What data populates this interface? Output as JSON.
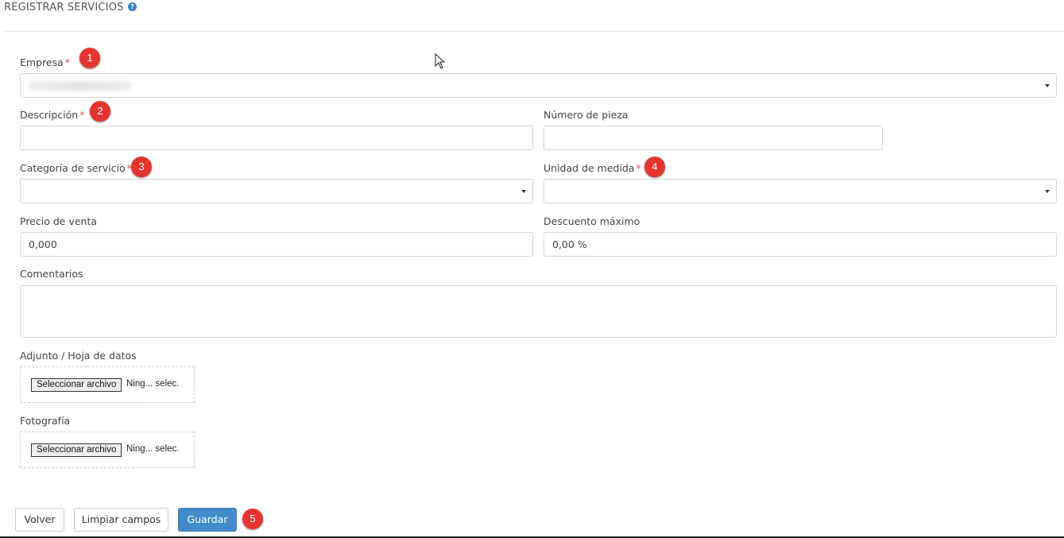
{
  "header": {
    "title": "REGISTRAR SERVICIOS",
    "help_icon": "?"
  },
  "form": {
    "empresa": {
      "label": "Empresa",
      "required": "*",
      "value_redacted": true
    },
    "descripcion": {
      "label": "Descripción",
      "required": "*",
      "value": ""
    },
    "numero_pieza": {
      "label": "Número de pieza",
      "value": ""
    },
    "categoria": {
      "label": "Categoría de servicio",
      "required": "*",
      "value": ""
    },
    "unidad": {
      "label": "Unidad de medida",
      "required": "*",
      "value": ""
    },
    "precio": {
      "label": "Precio de venta",
      "value": "0,000"
    },
    "descuento": {
      "label": "Descuento máximo",
      "value": "0,00 %"
    },
    "comentarios": {
      "label": "Comentarios",
      "value": ""
    },
    "adjunto": {
      "label": "Adjunto / Hoja de datos",
      "button": "Seleccionar archivo",
      "status": "Ning... selec."
    },
    "fotografia": {
      "label": "Fotografía",
      "button": "Seleccionar archivo",
      "status": "Ning... selec."
    }
  },
  "actions": {
    "back": "Volver",
    "clear": "Limpiar campos",
    "save": "Guardar"
  },
  "badges": [
    "1",
    "2",
    "3",
    "4",
    "5"
  ],
  "colors": {
    "required": "#d9534f",
    "primary": "#428bca",
    "badge": "#e53530",
    "help": "#3a7fc6"
  }
}
